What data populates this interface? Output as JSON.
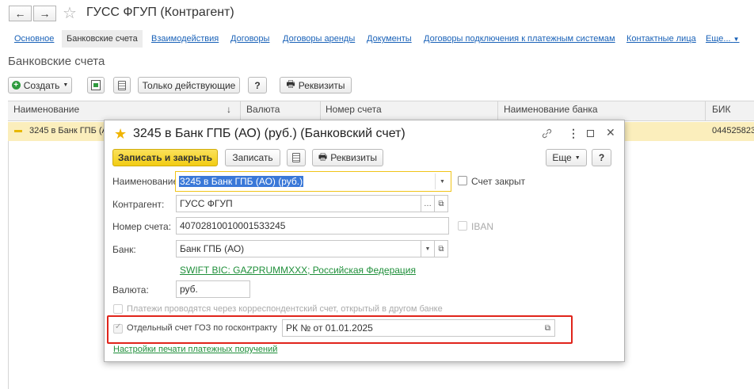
{
  "window": {
    "title": "ГУСС ФГУП (Контрагент)",
    "nav_back": "←",
    "nav_forward": "→",
    "star": "☆"
  },
  "tabs": [
    {
      "label": "Основное",
      "active": false
    },
    {
      "label": "Банковские счета",
      "active": true
    },
    {
      "label": "Взаимодействия",
      "active": false
    },
    {
      "label": "Договоры",
      "active": false
    },
    {
      "label": "Договоры аренды",
      "active": false
    },
    {
      "label": "Документы",
      "active": false
    },
    {
      "label": "Договоры подключения к платежным системам",
      "active": false
    },
    {
      "label": "Контактные лица",
      "active": false
    },
    {
      "label": "Еще...",
      "active": false
    }
  ],
  "section_title": "Банковские счета",
  "toolbar": {
    "create_label": "Создать",
    "only_active_label": "Только действующие",
    "help_label": "?",
    "requisites_label": "Реквизиты"
  },
  "table": {
    "columns": [
      "Наименование",
      "Валюта",
      "Номер счета",
      "Наименование банка",
      "БИК"
    ],
    "sort_arrow": "↓",
    "rows": [
      {
        "name": "3245 в Банк ГПБ (АО) (руб.)",
        "bik": "044525823"
      }
    ]
  },
  "dialog": {
    "title": "3245 в Банк ГПБ (АО) (руб.) (Банковский счет)",
    "star": "★",
    "header_icons": {
      "link": "🔗",
      "menu": "⋮",
      "maximize": "□",
      "close": "✕"
    },
    "save_close_label": "Записать и закрыть",
    "save_label": "Записать",
    "requisites_label": "Реквизиты",
    "more_label": "Еще",
    "help_label": "?",
    "fields": {
      "name_label": "Наименование:",
      "name_value": "3245 в Банк ГПБ (АО) (руб.)",
      "closed_label": "Счет закрыт",
      "contractor_label": "Контрагент:",
      "contractor_value": "ГУСС ФГУП",
      "account_label": "Номер счета:",
      "account_value": "40702810010001533245",
      "iban_label": "IBAN",
      "bank_label": "Банк:",
      "bank_value": "Банк ГПБ (АО)",
      "swift_link": "SWIFT BIC: GAZPRUMMXXX; Российская Федерация",
      "currency_label": "Валюта:",
      "currency_value": "руб.",
      "correspondent_label": "Платежи проводятся через корреспондентский счет, открытый в другом банке",
      "goz_label": "Отдельный счет ГОЗ по госконтракту",
      "goz_value": "РК  № от 01.01.2025",
      "print_settings_link": "Настройки печати платежных поручений"
    }
  },
  "colors": {
    "accent_yellow": "#f5d21f",
    "highlight_red": "#e0241b",
    "link_blue": "#1a62b8",
    "link_green": "#1f8f3a",
    "selection_blue": "#3a78d8"
  }
}
